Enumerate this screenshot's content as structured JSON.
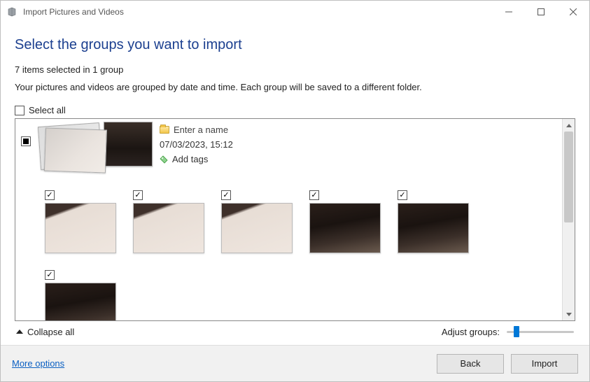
{
  "window": {
    "title": "Import Pictures and Videos"
  },
  "page": {
    "heading": "Select the groups you want to import",
    "status": "7 items selected in 1 group",
    "description": "Your pictures and videos are grouped by date and time. Each group will be saved to a different folder.",
    "select_all_label": "Select all"
  },
  "group": {
    "name_placeholder": "Enter a name",
    "timestamp": "07/03/2023, 15:12",
    "add_tags_label": "Add tags"
  },
  "controls": {
    "collapse_label": "Collapse all",
    "adjust_label": "Adjust groups:"
  },
  "footer": {
    "more_options": "More options",
    "back": "Back",
    "import": "Import"
  }
}
